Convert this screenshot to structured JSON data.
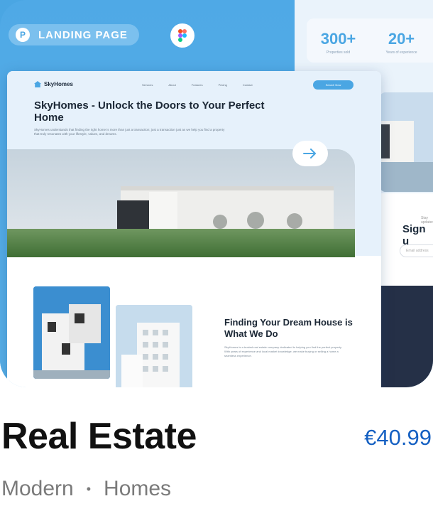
{
  "product": {
    "title": "Real Estate",
    "price": "€40.99",
    "tags": [
      "Modern",
      "Homes"
    ]
  },
  "preview": {
    "badge": "LANDING PAGE",
    "stats": [
      {
        "value": "300+",
        "label": "Properties sold"
      },
      {
        "value": "20+",
        "label": "Years of experience"
      }
    ],
    "mock": {
      "logo": "SkyHomes",
      "nav_links": [
        "Services",
        "About",
        "Features",
        "Pricing",
        "Contact"
      ],
      "nav_cta": "Search Now",
      "hero_title": "SkyHomes - Unlock the Doors to Your Perfect Home",
      "hero_desc": "SkyHomes understands that finding the right home is more than just a transaction; just a transaction just as we help you find a property that truly resonates with your lifestyle, values, and dreams.",
      "section_title": "Finding Your Dream House is What We Do",
      "section_desc": "SkyHomes is a trusted real estate company dedicated to helping you find the perfect property. With years of experience and local market knowledge, we make buying or selling a home a seamless experience."
    },
    "side": {
      "small_text": "Stay updated",
      "sign_text": "Sign u",
      "input_placeholder": "Email address"
    }
  },
  "colors": {
    "accent": "#4aa6e3",
    "price": "#1560c2"
  }
}
